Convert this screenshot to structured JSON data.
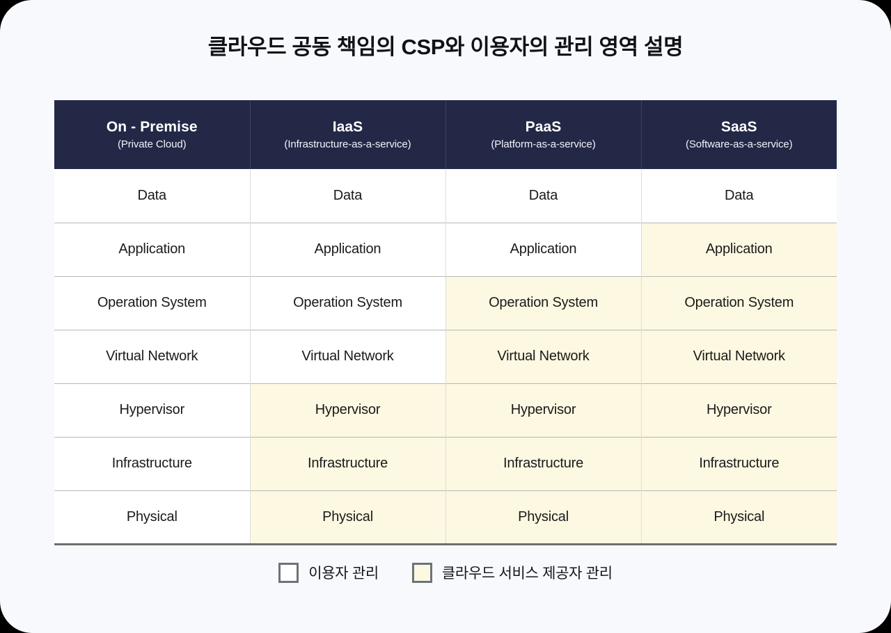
{
  "page": {
    "title": "클라우드 공동 책임의 CSP와 이용자의 관리 영역 설명",
    "background_color": "#F8F9FD"
  },
  "colors": {
    "header_navy": "#232847",
    "csp_highlight": "#FDF8E1",
    "user_cell": "#FFFFFF",
    "row_line": "#B7B7B7",
    "column_line": "#DCDCDC",
    "table_bottom_line": "#6E6E6E",
    "swatch_border": "#6E7378",
    "title_text": "#111218"
  },
  "table": {
    "columns": [
      {
        "name": "On - Premise",
        "subtitle": "(Private Cloud)"
      },
      {
        "name": "IaaS",
        "subtitle": "(Infrastructure-as-a-service)"
      },
      {
        "name": "PaaS",
        "subtitle": "(Platform-as-a-service)"
      },
      {
        "name": "SaaS",
        "subtitle": "(Software-as-a-service)"
      }
    ],
    "rows": [
      {
        "layer": "Data",
        "cells": [
          {
            "label": "Data",
            "managed_by": "user"
          },
          {
            "label": "Data",
            "managed_by": "user"
          },
          {
            "label": "Data",
            "managed_by": "user"
          },
          {
            "label": "Data",
            "managed_by": "user"
          }
        ]
      },
      {
        "layer": "Application",
        "cells": [
          {
            "label": "Application",
            "managed_by": "user"
          },
          {
            "label": "Application",
            "managed_by": "user"
          },
          {
            "label": "Application",
            "managed_by": "user"
          },
          {
            "label": "Application",
            "managed_by": "csp"
          }
        ]
      },
      {
        "layer": "Operation System",
        "cells": [
          {
            "label": "Operation System",
            "managed_by": "user"
          },
          {
            "label": "Operation System",
            "managed_by": "user"
          },
          {
            "label": "Operation System",
            "managed_by": "csp"
          },
          {
            "label": "Operation System",
            "managed_by": "csp"
          }
        ]
      },
      {
        "layer": "Virtual Network",
        "cells": [
          {
            "label": "Virtual Network",
            "managed_by": "user"
          },
          {
            "label": "Virtual Network",
            "managed_by": "user"
          },
          {
            "label": "Virtual Network",
            "managed_by": "csp"
          },
          {
            "label": "Virtual Network",
            "managed_by": "csp"
          }
        ]
      },
      {
        "layer": "Hypervisor",
        "cells": [
          {
            "label": "Hypervisor",
            "managed_by": "user"
          },
          {
            "label": "Hypervisor",
            "managed_by": "csp"
          },
          {
            "label": "Hypervisor",
            "managed_by": "csp"
          },
          {
            "label": "Hypervisor",
            "managed_by": "csp"
          }
        ]
      },
      {
        "layer": "Infrastructure",
        "cells": [
          {
            "label": "Infrastructure",
            "managed_by": "user"
          },
          {
            "label": "Infrastructure",
            "managed_by": "csp"
          },
          {
            "label": "Infrastructure",
            "managed_by": "csp"
          },
          {
            "label": "Infrastructure",
            "managed_by": "csp"
          }
        ]
      },
      {
        "layer": "Physical",
        "cells": [
          {
            "label": "Physical",
            "managed_by": "user"
          },
          {
            "label": "Physical",
            "managed_by": "csp"
          },
          {
            "label": "Physical",
            "managed_by": "csp"
          },
          {
            "label": "Physical",
            "managed_by": "csp"
          }
        ]
      }
    ]
  },
  "legend": {
    "items": [
      {
        "key": "user",
        "label": "이용자 관리",
        "swatch_color": "#FFFFFF"
      },
      {
        "key": "csp",
        "label": "클라우드 서비스 제공자 관리",
        "swatch_color": "#FDF8E1"
      }
    ]
  }
}
